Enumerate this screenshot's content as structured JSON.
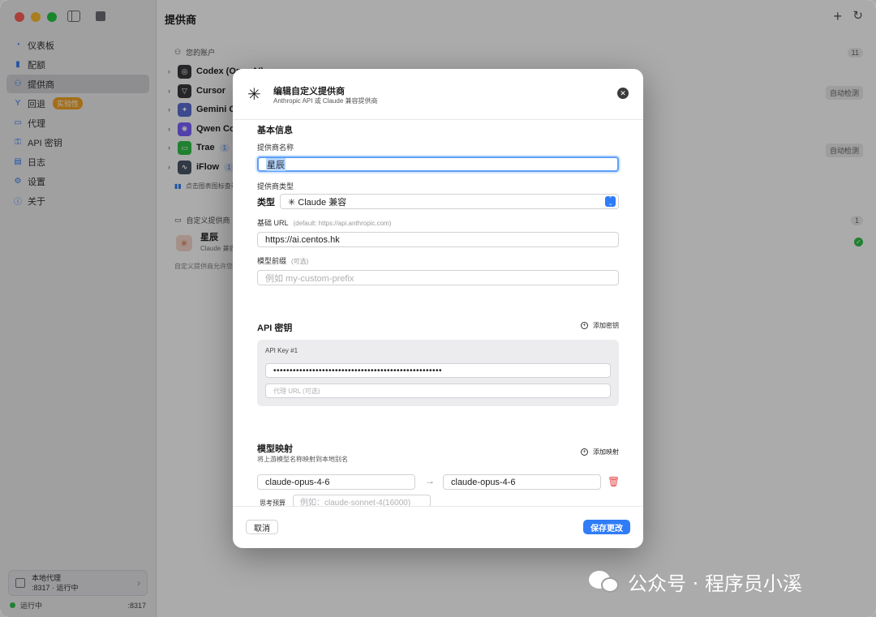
{
  "window": {
    "main_title": "提供商"
  },
  "sidebar": {
    "items": [
      {
        "label": "仪表板",
        "icon": "gauge-icon"
      },
      {
        "label": "配额",
        "icon": "chart-icon"
      },
      {
        "label": "提供商",
        "icon": "people-icon",
        "active": true
      },
      {
        "label": "回退",
        "icon": "fork-icon",
        "badge": "实验性"
      },
      {
        "label": "代理",
        "icon": "window-icon"
      },
      {
        "label": "API 密钥",
        "icon": "key-icon"
      },
      {
        "label": "日志",
        "icon": "doc-icon"
      },
      {
        "label": "设置",
        "icon": "gear-icon"
      },
      {
        "label": "关于",
        "icon": "info-icon"
      }
    ],
    "proxy": {
      "title": "本地代理",
      "subtitle": ":8317 · 运行中"
    },
    "status": {
      "label": "运行中",
      "port": ":8317"
    }
  },
  "main": {
    "accounts_header": "您的账户",
    "accounts_count": "11",
    "providers": [
      {
        "name": "Codex (OpenAI)",
        "icon_glyph": "◎",
        "badge": ""
      },
      {
        "name": "Cursor",
        "icon_glyph": "▽",
        "badge": "",
        "auto": "自动检测"
      },
      {
        "name": "Gemini CLI",
        "icon_glyph": "✦",
        "badge": ""
      },
      {
        "name": "Qwen Code",
        "icon_glyph": "✺",
        "badge": ""
      },
      {
        "name": "Trae",
        "icon_glyph": "▭",
        "badge": "1",
        "auto": "自动检测"
      },
      {
        "name": "iFlow",
        "icon_glyph": "∿",
        "badge": "1"
      }
    ],
    "hint": "点击图表图标查看",
    "custom_header": "自定义提供商",
    "custom_count": "1",
    "custom_item": {
      "name": "星辰",
      "sub": "Claude 兼容"
    },
    "custom_footer": "自定义提供商允许您"
  },
  "modal": {
    "title": "编辑自定义提供商",
    "subtitle": "Anthropic API 或 Claude 兼容提供商",
    "basic_info": "基本信息",
    "name_label": "提供商名称",
    "name_value": "星辰",
    "type_label": "提供商类型",
    "type_prefix": "类型",
    "type_value": "✳ Claude 兼容",
    "base_url_label": "基础 URL",
    "base_url_hint": "(default: https://api.anthropic.com)",
    "base_url_value": "https://ai.centos.hk",
    "prefix_label": "模型前缀",
    "prefix_hint": "(可选)",
    "prefix_placeholder": "例如 my-custom-prefix",
    "api_section": "API 密钥",
    "add_key": "添加密钥",
    "key_label": "API Key #1",
    "key_value": "••••••••••••••••••••••••••••••••••••••••••••••••••••",
    "proxy_url_placeholder": "代理 URL (可选)",
    "mapping_section": "模型映射",
    "mapping_sub": "将上游模型名称映射到本地别名",
    "add_mapping": "添加映射",
    "mapping": {
      "from": "claude-opus-4-6",
      "to": "claude-opus-4-6"
    },
    "think_label": "思考预算",
    "think_placeholder": "例如：claude-sonnet-4(16000)",
    "cancel": "取消",
    "save": "保存更改"
  },
  "watermark": "公众号 · 程序员小溪",
  "colors": {
    "accent": "#2f7cf6",
    "danger": "#e5484d",
    "success": "#30c048",
    "experimental": "#f5a524"
  }
}
